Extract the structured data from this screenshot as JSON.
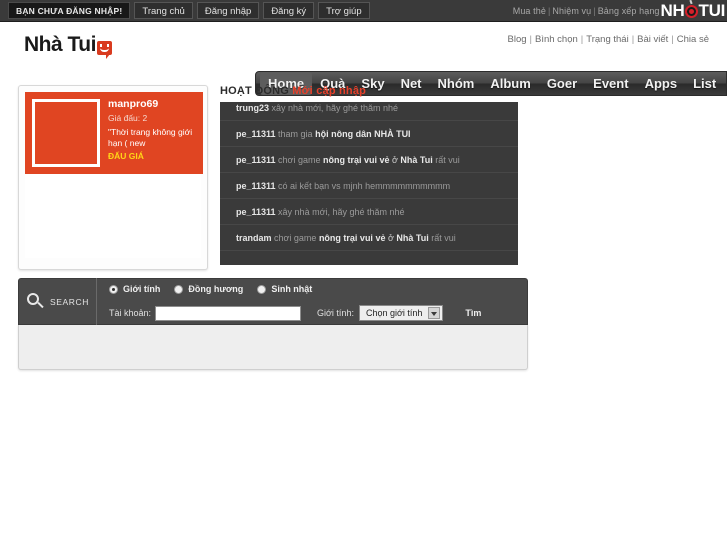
{
  "topbar": {
    "status_label": "BẠN CHƯA ĐĂNG NHẬP!",
    "buttons": [
      {
        "label": "Trang chủ"
      },
      {
        "label": "Đăng nhập"
      },
      {
        "label": "Đăng ký"
      },
      {
        "label": "Trợ giúp"
      }
    ],
    "right_links": [
      {
        "label": "Mua thẻ"
      },
      {
        "label": "Nhiệm vụ"
      },
      {
        "label": "Bảng xếp hạng"
      }
    ],
    "separator": "|",
    "logo_before": "NH",
    "logo_after": "TUI"
  },
  "header": {
    "site_logo": "Nhà Tui",
    "sublinks": [
      {
        "label": "Blog"
      },
      {
        "label": "Bình chọn"
      },
      {
        "label": "Trạng thái"
      },
      {
        "label": "Bài viết"
      },
      {
        "label": "Chia sẻ"
      }
    ],
    "sublink_separator": "|"
  },
  "nav": {
    "items": [
      {
        "label": "Home",
        "active": true
      },
      {
        "label": "Quà",
        "active": false
      },
      {
        "label": "Sky",
        "active": false
      },
      {
        "label": "Net",
        "active": false
      },
      {
        "label": "Nhóm",
        "active": false
      },
      {
        "label": "Album",
        "active": false
      },
      {
        "label": "Goer",
        "active": false
      },
      {
        "label": "Event",
        "active": false
      },
      {
        "label": "Apps",
        "active": false
      },
      {
        "label": "List",
        "active": false
      }
    ]
  },
  "auction": {
    "user": "manpro69",
    "price_label": "Giá đấu: 2",
    "description": "\"Thời trang không giới hạn ( new",
    "cta": "ĐẤU GIÁ",
    "accent_color": "#e04522",
    "cta_color": "#ffd617"
  },
  "activity": {
    "title": "HOẠT ĐỘNG",
    "title_highlight": "Mới cập nhập",
    "highlight_color": "#e8402a",
    "rows": [
      {
        "user": "trung23",
        "rest": " xây nhà mới, hãy ghé thăm nhé"
      },
      {
        "user": "pe_11311",
        "rest": " tham gia ",
        "emphasis": "hội nông dân NHÀ TUI",
        "tail": ""
      },
      {
        "user": "pe_11311",
        "rest": " chơi game ",
        "emphasis": "nông trại vui vẻ",
        "mid": " ở ",
        "place": "Nhà Tui",
        "tail": " rất vui"
      },
      {
        "user": "pe_11311",
        "rest": " có ai kết bạn vs mjnh hemmmmmmmmmm"
      },
      {
        "user": "pe_11311",
        "rest": " xây nhà mới, hãy ghé thăm nhé"
      },
      {
        "user": "trandam",
        "rest": " chơi game ",
        "emphasis": "nông trại vui vẻ",
        "mid": " ở ",
        "place": "Nhà Tui",
        "tail": " rất vui"
      }
    ]
  },
  "search": {
    "label": "SEARCH",
    "options": [
      {
        "label": "Giới tính",
        "selected": true
      },
      {
        "label": "Đồng hương",
        "selected": false
      },
      {
        "label": "Sinh nhật",
        "selected": false
      }
    ],
    "account_label": "Tài khoản:",
    "account_value": "",
    "account_placeholder": "",
    "gender_label": "Giới tính:",
    "gender_selected": "Chọn giới tính",
    "submit_label": "Tìm"
  }
}
